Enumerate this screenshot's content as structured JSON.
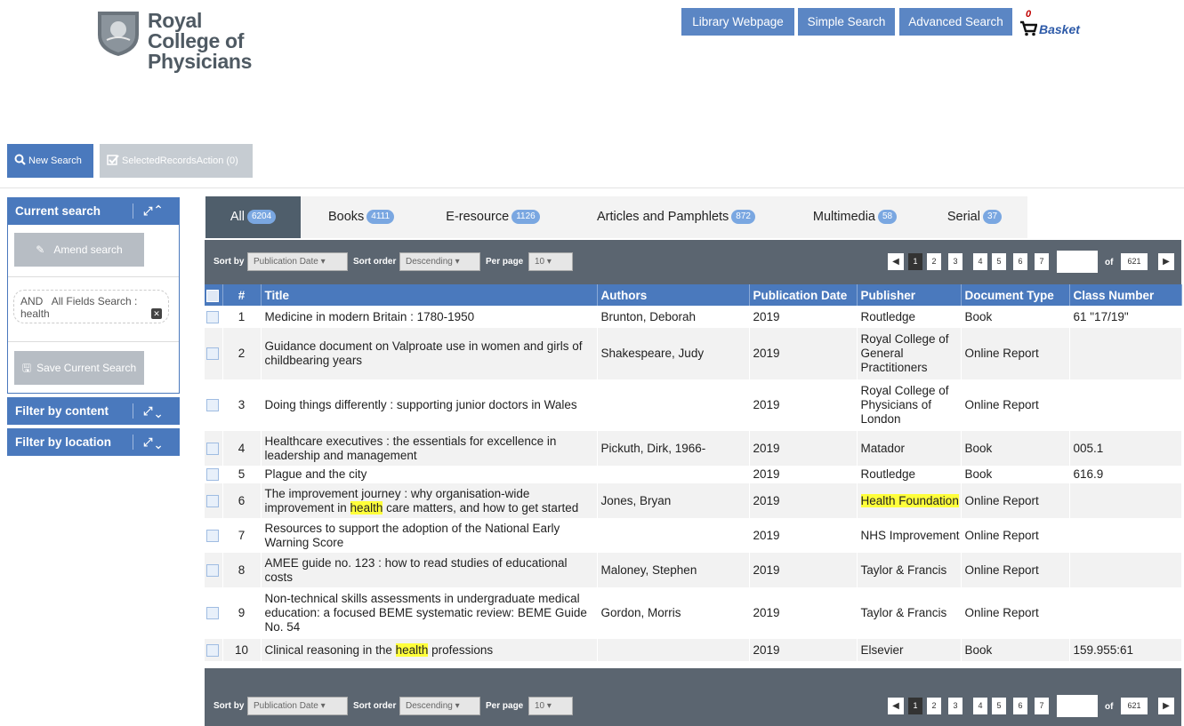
{
  "header": {
    "logo_text": "Royal College of Physicians",
    "nav": [
      "Library Webpage",
      "Simple Search",
      "Advanced Search"
    ],
    "basket_count": "0",
    "basket_label": "Basket"
  },
  "actions": {
    "new_search": "New Search",
    "selected_records": "SelectedRecordsAction (0)"
  },
  "sidebar": {
    "current_search_title": "Current search",
    "amend_search": "Amend search",
    "criterion": {
      "operator": "AND",
      "field": "All Fields Search :",
      "value": "health"
    },
    "save_search": "Save Current Search",
    "filter_content": "Filter by content",
    "filter_location": "Filter by location"
  },
  "tabs": [
    {
      "label": "All",
      "count": "6204",
      "active": true
    },
    {
      "label": "Books",
      "count": "4111"
    },
    {
      "label": "E-resource",
      "count": "1126"
    },
    {
      "label": "Articles and Pamphlets",
      "count": "872"
    },
    {
      "label": "Multimedia",
      "count": "58"
    },
    {
      "label": "Serial",
      "count": "37"
    }
  ],
  "toolbar": {
    "sort_by_label": "Sort by",
    "sort_by_value": "Publication Date",
    "sort_order_label": "Sort order",
    "sort_order_value": "Descending",
    "per_page_label": "Per page",
    "per_page_value": "10",
    "pages": [
      "1",
      "2",
      "3",
      "4",
      "5",
      "6",
      "7"
    ],
    "current_page": "1",
    "of_label": "of",
    "total_pages": "621"
  },
  "table": {
    "columns": [
      "#",
      "Title",
      "Authors",
      "Publication Date",
      "Publisher",
      "Document Type",
      "Class Number"
    ],
    "rows": [
      {
        "n": "1",
        "title": "Medicine in modern Britain : 1780-1950",
        "author": "Brunton, Deborah",
        "date": "2019",
        "publisher": "Routledge",
        "type": "Book",
        "class": "61 \"17/19\""
      },
      {
        "n": "2",
        "title": "Guidance document on Valproate use in women and girls of childbearing years",
        "author": "Shakespeare, Judy",
        "date": "2019",
        "publisher": "Royal College of General Practitioners",
        "type": "Online Report",
        "class": ""
      },
      {
        "n": "3",
        "title": "Doing things differently : supporting junior doctors in Wales",
        "author": "",
        "date": "2019",
        "publisher": "Royal College of Physicians of London",
        "type": "Online Report",
        "class": ""
      },
      {
        "n": "4",
        "title": "Healthcare executives : the essentials for excellence in leadership and management",
        "author": "Pickuth, Dirk, 1966-",
        "date": "2019",
        "publisher": "Matador",
        "type": "Book",
        "class": "005.1"
      },
      {
        "n": "5",
        "title": "Plague and the city",
        "author": "",
        "date": "2019",
        "publisher": "Routledge",
        "type": "Book",
        "class": "616.9"
      },
      {
        "n": "6",
        "title_parts": [
          "The improvement journey : why organisation-wide improvement in ",
          "health",
          " care matters, and how to get started"
        ],
        "author": "Jones, Bryan",
        "date": "2019",
        "publisher": "Health Foundation",
        "publisher_highlight": true,
        "type": "Online Report",
        "class": ""
      },
      {
        "n": "7",
        "title": "Resources to support the adoption of the National Early Warning Score",
        "author": "",
        "date": "2019",
        "publisher": "NHS Improvement",
        "type": "Online Report",
        "class": ""
      },
      {
        "n": "8",
        "title": "AMEE guide no. 123 : how to read studies of educational costs",
        "author": "Maloney, Stephen",
        "date": "2019",
        "publisher": "Taylor & Francis",
        "type": "Online Report",
        "class": ""
      },
      {
        "n": "9",
        "title": "Non-technical skills assessments in undergraduate medical education: a focused BEME systematic review: BEME Guide No. 54",
        "author": "Gordon, Morris",
        "date": "2019",
        "publisher": "Taylor & Francis",
        "type": "Online Report",
        "class": ""
      },
      {
        "n": "10",
        "title_parts": [
          "Clinical reasoning in the ",
          "health",
          " professions"
        ],
        "author": "",
        "date": "2019",
        "publisher": "Elsevier",
        "type": "Book",
        "class": "159.955:61"
      }
    ]
  },
  "colors": {
    "accent": "#4a79bd",
    "toolbar": "#5b6570",
    "highlight": "#ffff3b",
    "active_tab": "#4f5e6b"
  }
}
